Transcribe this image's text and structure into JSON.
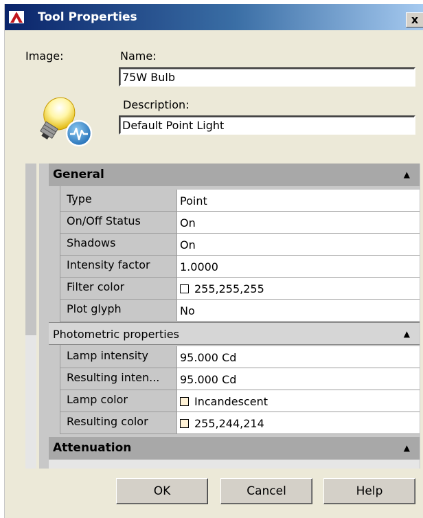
{
  "window": {
    "title": "Tool Properties",
    "close_label": "x"
  },
  "image_label": "Image:",
  "name": {
    "label": "Name:",
    "value": "75W Bulb"
  },
  "description": {
    "label": "Description:",
    "value": "Default Point Light"
  },
  "sections": {
    "general": {
      "title": "General",
      "rows": [
        {
          "key": "Type",
          "value": "Point"
        },
        {
          "key": "On/Off Status",
          "value": "On"
        },
        {
          "key": "Shadows",
          "value": "On"
        },
        {
          "key": "Intensity factor",
          "value": "1.0000"
        },
        {
          "key": "Filter color",
          "value": "255,255,255",
          "swatch": "#ffffff"
        },
        {
          "key": "Plot glyph",
          "value": "No"
        }
      ]
    },
    "photometric": {
      "title": "Photometric properties",
      "rows": [
        {
          "key": "Lamp intensity",
          "value": "95.000 Cd"
        },
        {
          "key": "Resulting inten...",
          "value": "95.000 Cd"
        },
        {
          "key": "Lamp color",
          "value": "Incandescent",
          "swatch": "#fff2d6"
        },
        {
          "key": "Resulting color",
          "value": "255,244,214",
          "swatch": "#fff2d6"
        }
      ]
    },
    "attenuation": {
      "title": "Attenuation"
    }
  },
  "buttons": {
    "ok": "OK",
    "cancel": "Cancel",
    "help": "Help"
  },
  "colors": {
    "title_start": "#0a246a",
    "title_end": "#a6caf0",
    "dialog_bg": "#ece9d8"
  },
  "icons": [
    "app-icon",
    "light-bulb-icon",
    "close-icon",
    "caret-up-icon"
  ]
}
